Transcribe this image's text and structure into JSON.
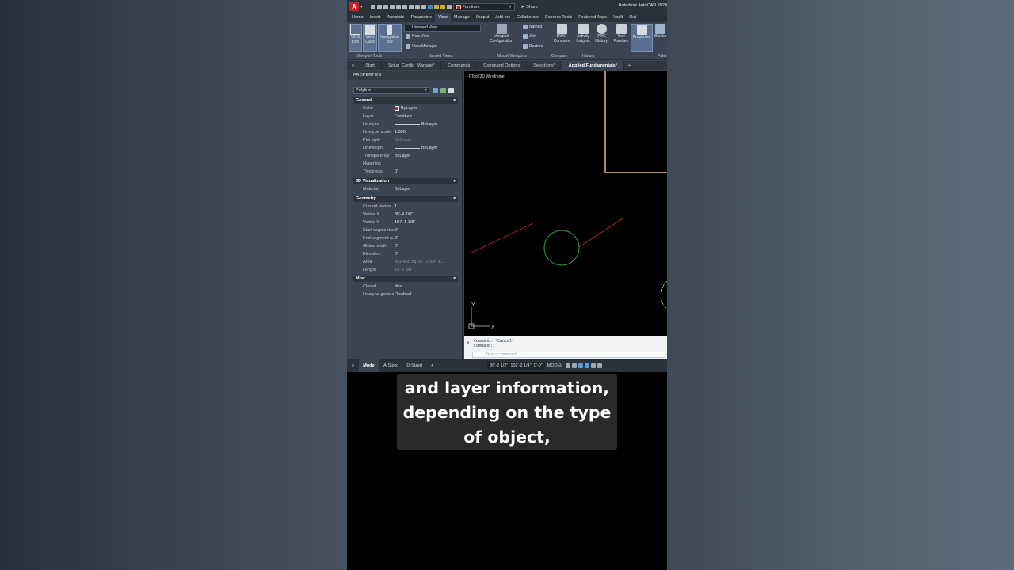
{
  "app": {
    "title": "Autodesk AutoCAD 2024",
    "logo_letter": "A",
    "current_layer": "Furniture",
    "share_label": "Share"
  },
  "ribbon_tabs": [
    "Home",
    "Insert",
    "Annotate",
    "Parametric",
    "View",
    "Manage",
    "Output",
    "Add-ins",
    "Collaborate",
    "Express Tools",
    "Featured Apps",
    "Vault",
    "Out"
  ],
  "ribbon_active_tab": "View",
  "ribbon": {
    "ucs_icon": "UCS Icon",
    "view_cube": "View Cube",
    "navigation_bar": "Navigation Bar",
    "viewport_tools": "Viewport Tools",
    "unsaved_view": "Unsaved View",
    "new_view": "New View",
    "view_manager": "View Manager",
    "named_views": "Named Views",
    "viewport_config": "Viewport Configuration",
    "named": "Named",
    "join": "Join",
    "restore": "Restore",
    "model_viewports": "Model Viewports",
    "dwg_compare": "DWG Compare",
    "compare": "Compare",
    "activity_insights": "Activity Insights",
    "dwg_history": "DWG History",
    "history": "History",
    "tool_palettes": "Tool Palettes",
    "properties": "Properties",
    "blocks": "Blocks",
    "palettes": "Palet"
  },
  "doc_tabs": [
    "Start",
    "Setup_Config_Manage*",
    "Commands",
    "Command Options",
    "Selections*",
    "Applied Fundamentals*"
  ],
  "doc_active_tab": "Applied Fundamentals*",
  "properties": {
    "title": "PROPERTIES",
    "object_type": "Polyline",
    "sections": {
      "general": "General",
      "visualization": "3D Visualization",
      "geometry": "Geometry",
      "misc": "Misc"
    },
    "general": [
      {
        "k": "Color",
        "v": "ByLayer"
      },
      {
        "k": "Layer",
        "v": "Furniture"
      },
      {
        "k": "Linetype",
        "v": "ByLayer"
      },
      {
        "k": "Linetype scale",
        "v": "1.000"
      },
      {
        "k": "Plot style",
        "v": "ByColor"
      },
      {
        "k": "Lineweight",
        "v": "ByLayer"
      },
      {
        "k": "Transparency",
        "v": "ByLayer"
      },
      {
        "k": "Hyperlink",
        "v": ""
      },
      {
        "k": "Thickness",
        "v": "0\""
      }
    ],
    "visualization": [
      {
        "k": "Material",
        "v": "ByLayer"
      }
    ],
    "geometry": [
      {
        "k": "Current Vertex",
        "v": "1"
      },
      {
        "k": "Vertex X",
        "v": "35'-4 7/8\""
      },
      {
        "k": "Vertex Y",
        "v": "107'-1 1/8\""
      },
      {
        "k": "Start segment w...",
        "v": "0\""
      },
      {
        "k": "End segment w...",
        "v": "0\""
      },
      {
        "k": "Global width",
        "v": "0\""
      },
      {
        "k": "Elevation",
        "v": "0\""
      },
      {
        "k": "Area",
        "v": "422.450 sq. in. (2.934 s..."
      },
      {
        "k": "Length",
        "v": "13'-5 3/8\""
      }
    ],
    "misc": [
      {
        "k": "Closed",
        "v": "Yes"
      },
      {
        "k": "Linetype genera...",
        "v": "Disabled"
      }
    ]
  },
  "viewport_label": "[-][Top][2D Wireframe]",
  "command": {
    "history": [
      "Command: *Cancel*",
      "Command:"
    ],
    "placeholder": "Type a command"
  },
  "status": {
    "layouts": [
      "Model",
      "A-Sized",
      "D-Sized"
    ],
    "active_layout": "Model",
    "coords": "36'-2 1/2\", 102'-2 1/4\", 0'-0\"",
    "mode": "MODEL"
  },
  "caption": [
    "and layer information,",
    "depending on the type",
    "of object,"
  ],
  "colors": {
    "accent_red": "#d21f26",
    "circle_green": "#2e9e3e",
    "line_red": "#c8232b",
    "frame_brown": "#b08a5a"
  }
}
